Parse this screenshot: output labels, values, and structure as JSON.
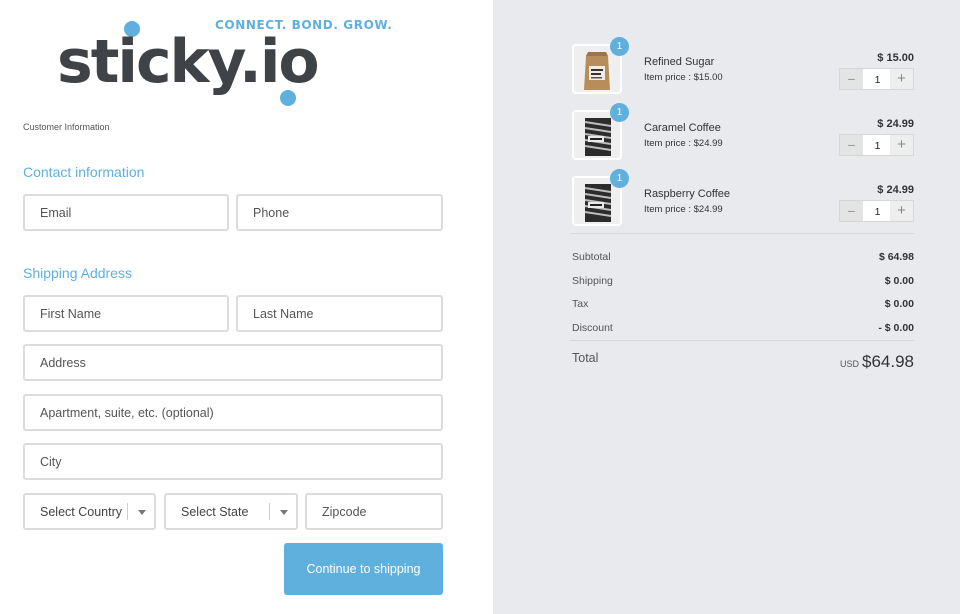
{
  "brand": {
    "wordmark": "sticky.io",
    "tagline": "CONNECT. BOND. GROW."
  },
  "breadcrumb": "Customer Information",
  "contact": {
    "title": "Contact information",
    "email_placeholder": "Email",
    "phone_placeholder": "Phone"
  },
  "shipping": {
    "title": "Shipping Address",
    "first_name_placeholder": "First Name",
    "last_name_placeholder": "Last Name",
    "address_placeholder": "Address",
    "apartment_placeholder": "Apartment, suite, etc. (optional)",
    "city_placeholder": "City",
    "country_label": "Select Country",
    "state_label": "Select State",
    "zip_placeholder": "Zipcode"
  },
  "continue_button": "Continue to shipping",
  "cart": {
    "items": [
      {
        "name": "Refined Sugar",
        "unit_price": "Item price : $15.00",
        "line_total": "$ 15.00",
        "qty": "1",
        "badge": "1",
        "icon": "sugar-bag-image"
      },
      {
        "name": "Caramel Coffee",
        "unit_price": "Item price : $24.99",
        "line_total": "$ 24.99",
        "qty": "1",
        "badge": "1",
        "icon": "coffee-bag-image"
      },
      {
        "name": "Raspberry Coffee",
        "unit_price": "Item price : $24.99",
        "line_total": "$ 24.99",
        "qty": "1",
        "badge": "1",
        "icon": "coffee-bag-image"
      }
    ],
    "stepper": {
      "minus": "−",
      "plus": "+"
    },
    "summary": {
      "subtotal_label": "Subtotal",
      "subtotal": "$ 64.98",
      "shipping_label": "Shipping",
      "shipping": "$ 0.00",
      "tax_label": "Tax",
      "tax": "$ 0.00",
      "discount_label": "Discount",
      "discount": "- $ 0.00"
    },
    "total": {
      "label": "Total",
      "currency": "USD",
      "amount": "$64.98"
    }
  },
  "colors": {
    "accent": "#5fb0dd",
    "panel_bg": "#e9eaee",
    "text_dark": "#3f4247"
  }
}
